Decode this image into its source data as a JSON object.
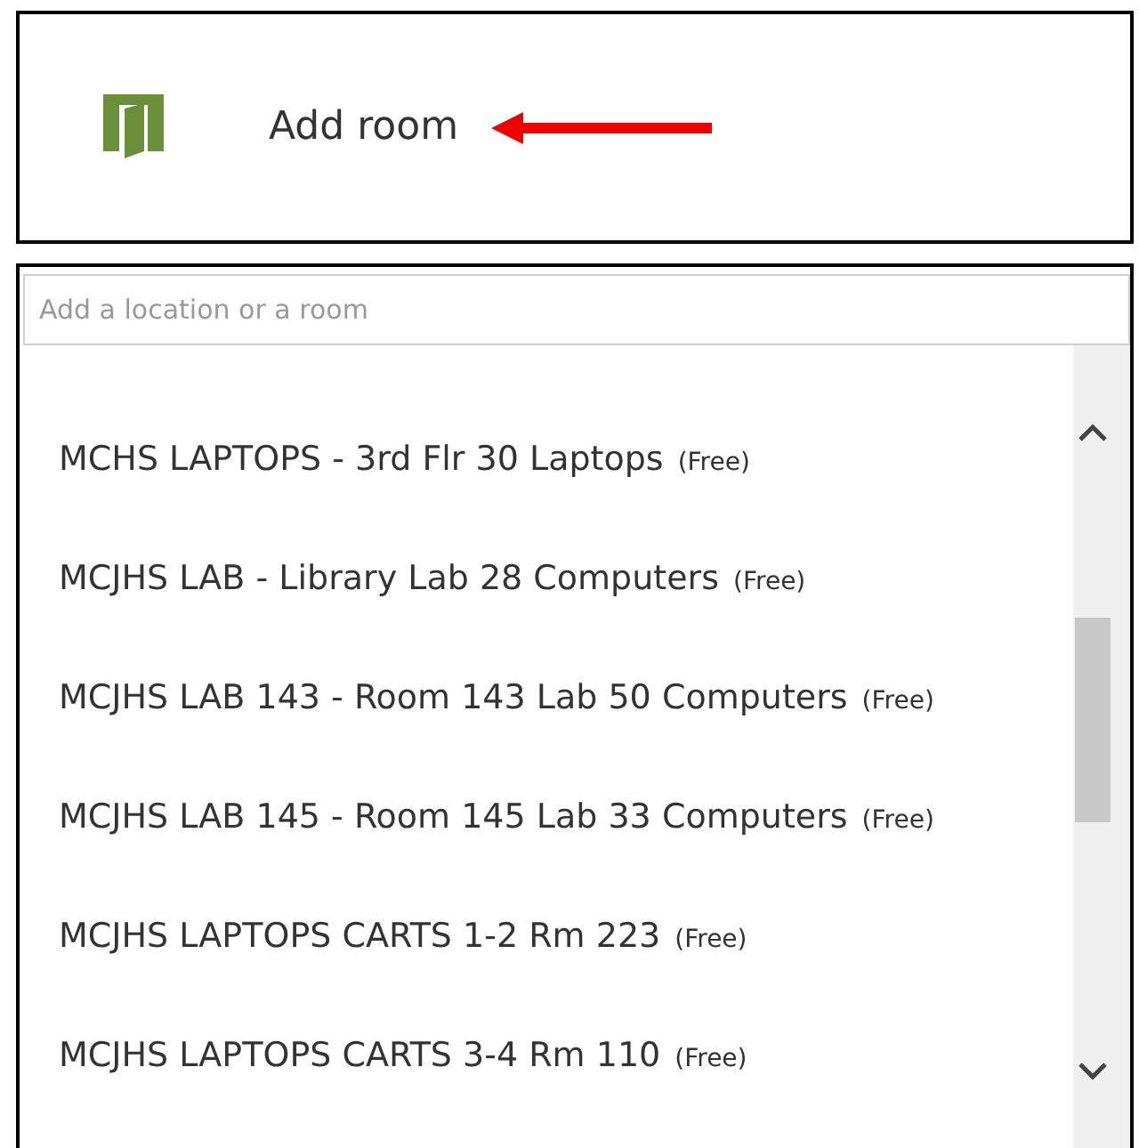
{
  "add_room": {
    "label": "Add room"
  },
  "search": {
    "placeholder": "Add a location or a room"
  },
  "rooms": [
    {
      "name": "MCHS LAPTOPS - 3rd Flr 30 Laptops",
      "status": "(Free)"
    },
    {
      "name": "MCJHS LAB - Library Lab 28 Computers",
      "status": "(Free)"
    },
    {
      "name": "MCJHS LAB 143 - Room 143 Lab 50 Computers",
      "status": "(Free)"
    },
    {
      "name": "MCJHS LAB 145 - Room 145 Lab 33 Computers",
      "status": "(Free)"
    },
    {
      "name": "MCJHS LAPTOPS CARTS 1-2 Rm 223",
      "status": "(Free)"
    },
    {
      "name": "MCJHS LAPTOPS CARTS 3-4 Rm 110",
      "status": "(Free)"
    }
  ]
}
